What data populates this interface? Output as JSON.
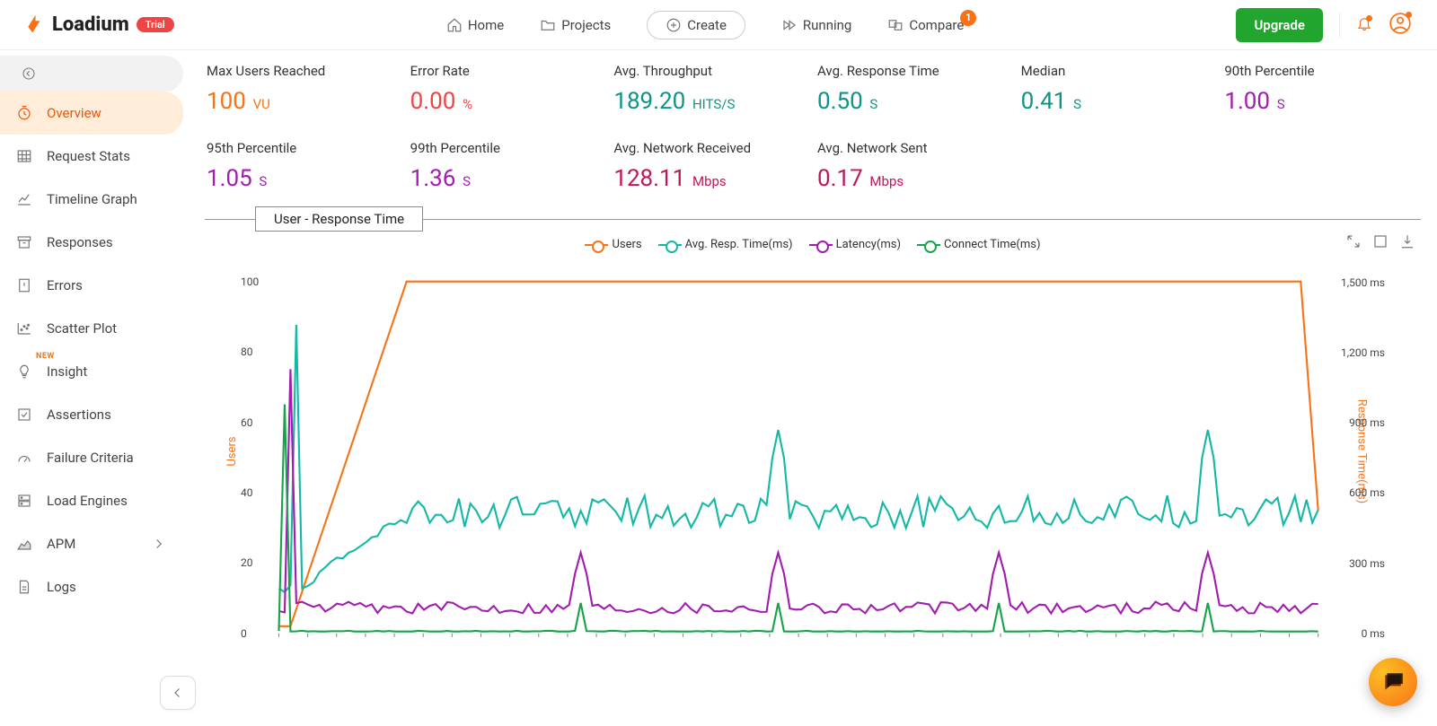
{
  "brand": {
    "name": "Loadium",
    "badge": "Trial"
  },
  "nav": {
    "home": "Home",
    "projects": "Projects",
    "create": "Create",
    "running": "Running",
    "compare": "Compare",
    "compare_badge": "1",
    "upgrade": "Upgrade"
  },
  "sidebar": {
    "items": [
      {
        "key": "overview",
        "label": "Overview",
        "icon": "timer"
      },
      {
        "key": "request-stats",
        "label": "Request Stats",
        "icon": "table"
      },
      {
        "key": "timeline-graph",
        "label": "Timeline Graph",
        "icon": "line-up"
      },
      {
        "key": "responses",
        "label": "Responses",
        "icon": "archive"
      },
      {
        "key": "errors",
        "label": "Errors",
        "icon": "alert-file"
      },
      {
        "key": "scatter-plot",
        "label": "Scatter Plot",
        "icon": "scatter"
      },
      {
        "key": "insight",
        "label": "Insight",
        "icon": "bulb",
        "new": "NEW"
      },
      {
        "key": "assertions",
        "label": "Assertions",
        "icon": "check-square"
      },
      {
        "key": "failure-criteria",
        "label": "Failure Criteria",
        "icon": "gauge"
      },
      {
        "key": "load-engines",
        "label": "Load Engines",
        "icon": "server"
      },
      {
        "key": "apm",
        "label": "APM",
        "icon": "area",
        "hasSub": true
      },
      {
        "key": "logs",
        "label": "Logs",
        "icon": "doc"
      }
    ]
  },
  "metrics": [
    {
      "label": "Max Users Reached",
      "value": "100",
      "unit": "VU",
      "color": "c-orange"
    },
    {
      "label": "Error Rate",
      "value": "0.00",
      "unit": "%",
      "color": "c-red"
    },
    {
      "label": "Avg. Throughput",
      "value": "189.20",
      "unit": "HITS/S",
      "color": "c-teal"
    },
    {
      "label": "Avg. Response Time",
      "value": "0.50",
      "unit": "S",
      "color": "c-teal"
    },
    {
      "label": "Median",
      "value": "0.41",
      "unit": "S",
      "color": "c-teal"
    },
    {
      "label": "90th Percentile",
      "value": "1.00",
      "unit": "S",
      "color": "c-purple"
    },
    {
      "label": "95th Percentile",
      "value": "1.05",
      "unit": "S",
      "color": "c-purple"
    },
    {
      "label": "99th Percentile",
      "value": "1.36",
      "unit": "S",
      "color": "c-purple"
    },
    {
      "label": "Avg. Network Received",
      "value": "128.11",
      "unit": "Mbps",
      "color": "c-magenta"
    },
    {
      "label": "Avg. Network Sent",
      "value": "0.17",
      "unit": "Mbps",
      "color": "c-magenta"
    }
  ],
  "chart_title": "User - Response Time",
  "legend": {
    "users": "Users",
    "resp": "Avg. Resp. Time(ms)",
    "latency": "Latency(ms)",
    "connect": "Connect Time(ms)"
  },
  "axis": {
    "left_label": "Users",
    "right_label": "Response Time(ms)"
  },
  "chart_data": {
    "type": "line",
    "left_axis": {
      "label": "Users",
      "ticks": [
        0,
        20,
        40,
        60,
        80,
        100
      ],
      "ylim": [
        0,
        105
      ]
    },
    "right_axis": {
      "label": "Response Time(ms)",
      "ticks": [
        "0 ms",
        "300 ms",
        "600 ms",
        "900 ms",
        "1,200 ms",
        "1,500 ms"
      ],
      "ylim": [
        0,
        1580
      ]
    },
    "n_points": 180,
    "series": [
      {
        "name": "Users",
        "axis": "left",
        "color": "#f97316",
        "shape": {
          "type": "ramp_plateau_drop",
          "start": 2,
          "ramp_end_idx": 22,
          "plateau": 100,
          "drop_start_idx": 176,
          "drop_to": 35
        }
      },
      {
        "name": "Avg. Resp. Time(ms)",
        "axis": "right",
        "color": "#14b8a6",
        "shape": {
          "type": "spike_then_noisy_plateau",
          "spike_idx": 3,
          "spike_val": 1320,
          "rise_to_idx": 22,
          "mean": 520,
          "jitter": 70,
          "peaks_at": [
            86,
            160
          ],
          "peak_val": 870
        }
      },
      {
        "name": "Latency(ms)",
        "axis": "right",
        "color": "#a21caf",
        "shape": {
          "type": "low_noisy_with_peaks",
          "mean": 110,
          "jitter": 25,
          "startup_spike_idx": 2,
          "startup_spike_val": 1130,
          "peaks_at": [
            52,
            86,
            124,
            160
          ],
          "peak_val": 345
        }
      },
      {
        "name": "Connect Time(ms)",
        "axis": "right",
        "color": "#16a34a",
        "shape": {
          "type": "floor_with_spikes",
          "floor": 8,
          "startup_spike_idx": 1,
          "startup_spike_val": 980,
          "peaks_at": [
            52,
            86,
            124,
            160
          ],
          "peak_val": 130
        }
      }
    ]
  }
}
